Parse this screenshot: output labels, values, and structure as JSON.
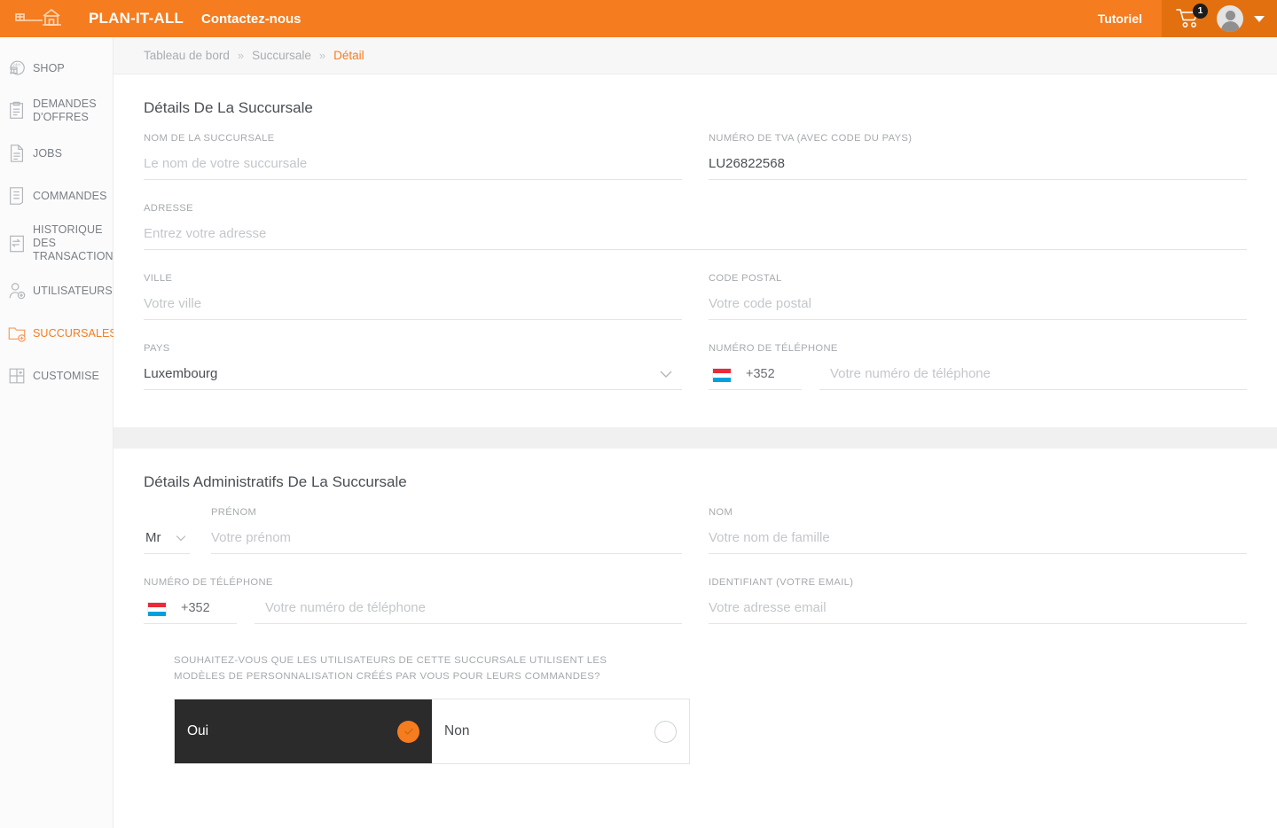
{
  "topbar": {
    "logo_icon": "shop-house-logo-icon",
    "brand": "PLAN-IT-ALL",
    "contact_label": "Contactez-nous",
    "tutoriel_label": "Tutoriel",
    "cart_icon": "shopping-cart-icon",
    "cart_badge": "1",
    "avatar_icon": "user-avatar-icon",
    "caret_icon": "caret-down-icon",
    "bg_color": "#f57c1f",
    "actions_bg_color": "#e2700f"
  },
  "sidebar": {
    "items": [
      {
        "label": "SHOP",
        "icon": "shop-24h-icon",
        "active": false
      },
      {
        "label": "DEMANDES D'OFFRES",
        "icon": "clipboard-icon",
        "active": false
      },
      {
        "label": "JOBS",
        "icon": "document-icon",
        "active": false
      },
      {
        "label": "COMMANDES",
        "icon": "order-list-icon",
        "active": false
      },
      {
        "label": "HISTORIQUE DES TRANSACTIONS",
        "icon": "transaction-history-icon",
        "active": false
      },
      {
        "label": "UTILISATEURS",
        "icon": "user-add-icon",
        "active": false
      },
      {
        "label": "SUCCURSALES",
        "icon": "folder-add-icon",
        "active": true
      },
      {
        "label": "CUSTOMISE",
        "icon": "customise-grid-icon",
        "active": false
      }
    ],
    "active_color": "#f57c1f",
    "inactive_color": "#7a7f85"
  },
  "breadcrumb": {
    "item1": "Tableau de bord",
    "sep1": "»",
    "item2": "Succursale",
    "sep2": "»",
    "current": "Détail"
  },
  "section1": {
    "title": "Détails De La Succursale",
    "branch_name": {
      "label": "NOM DE LA SUCCURSALE",
      "value": "",
      "placeholder": "Le nom de votre succursale"
    },
    "vat": {
      "label": "NUMÉRO DE TVA (AVEC CODE DU PAYS)",
      "value": "LU26822568",
      "placeholder": ""
    },
    "address": {
      "label": "ADRESSE",
      "value": "",
      "placeholder": "Entrez votre adresse"
    },
    "city": {
      "label": "VILLE",
      "value": "",
      "placeholder": "Votre ville"
    },
    "postal": {
      "label": "CODE POSTAL",
      "value": "",
      "placeholder": "Votre code postal"
    },
    "country": {
      "label": "PAYS",
      "value": "Luxembourg",
      "chevron_icon": "chevron-down-icon"
    },
    "phone": {
      "label": "NUMÉRO DE TÉLÉPHONE",
      "country_code": "+352",
      "flag_icon": "luxembourg-flag-icon",
      "value": "",
      "placeholder": "Votre numéro de téléphone"
    }
  },
  "section2": {
    "title": "Détails Administratifs De La Succursale",
    "civility": {
      "value": "Mr",
      "chevron_icon": "chevron-down-icon"
    },
    "firstname": {
      "label": "PRÉNOM",
      "value": "",
      "placeholder": "Votre prénom"
    },
    "lastname": {
      "label": "NOM",
      "value": "",
      "placeholder": "Votre nom de famille"
    },
    "phone": {
      "label": "NUMÉRO DE TÉLÉPHONE",
      "country_code": "+352",
      "flag_icon": "luxembourg-flag-icon",
      "value": "",
      "placeholder": "Votre numéro de téléphone"
    },
    "email": {
      "label": "IDENTIFIANT (VOTRE EMAIL)",
      "value": "",
      "placeholder": "Votre adresse email"
    },
    "question": {
      "text": "SOUHAITEZ-VOUS QUE LES UTILISATEURS DE CETTE SUCCURSALE UTILISENT LES MODÈLES DE PERSONNALISATION CRÉÉS PAR VOUS POUR LEURS COMMANDES?",
      "option_yes": "Oui",
      "option_no": "Non",
      "selected": "Oui",
      "check_icon": "check-circle-icon",
      "radio_icon": "radio-empty-icon"
    }
  },
  "colors": {
    "accent": "#f57c1f",
    "selected_card_bg": "#2b2b2b",
    "text": "#4a4f54",
    "muted": "#a6aaae",
    "placeholder": "#c3c7cb",
    "panel_gap": "#f0f0f0"
  }
}
